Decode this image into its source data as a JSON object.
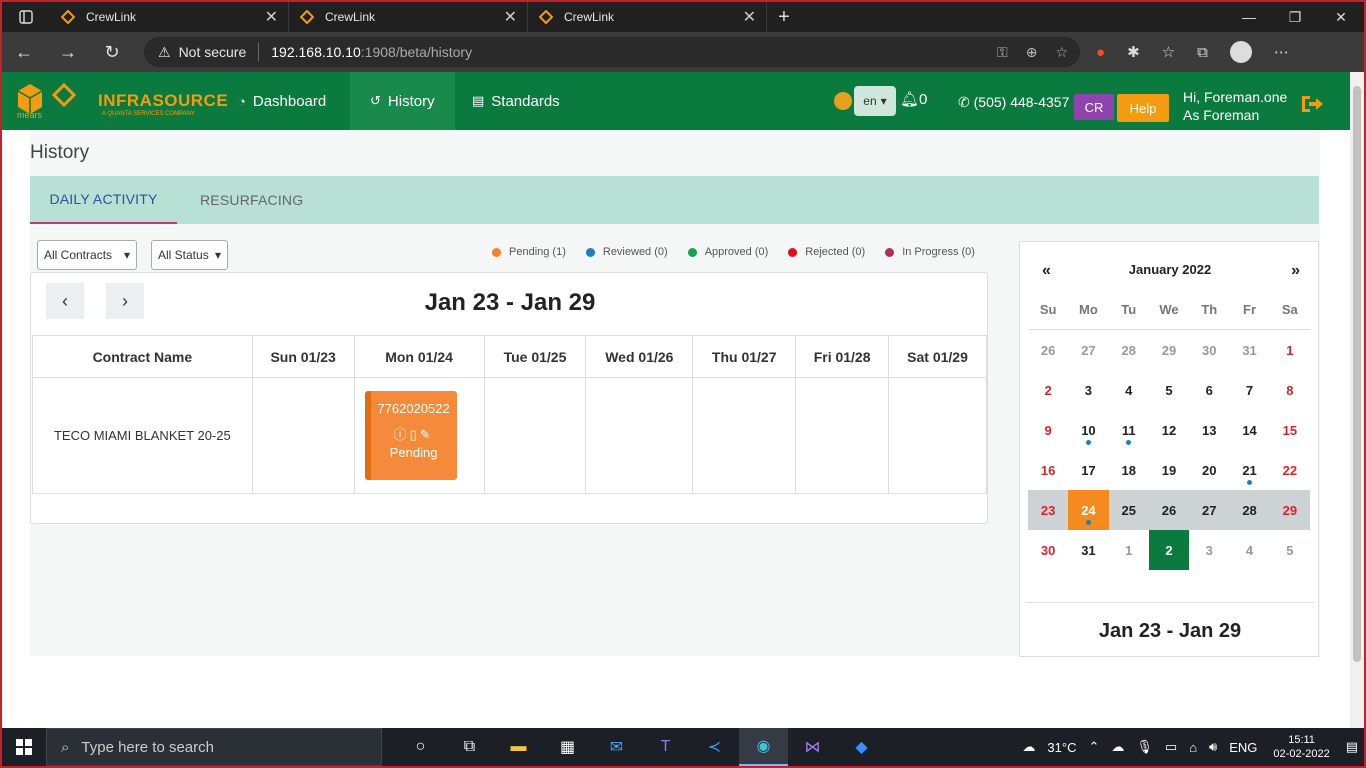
{
  "browser": {
    "tabs": [
      {
        "title": "CrewLink"
      },
      {
        "title": "CrewLink"
      },
      {
        "title": "CrewLink"
      }
    ],
    "security_label": "Not secure",
    "url_host": "192.168.10.10",
    "url_path": ":1908/beta/history"
  },
  "header": {
    "brand": "INFRASOURCE",
    "brand_sub": "A QUANTA SERVICES COMPANY",
    "mears": "mears",
    "nav": [
      {
        "label": "Dashboard",
        "icon": "dashboard-icon"
      },
      {
        "label": "History",
        "icon": "history-icon"
      },
      {
        "label": "Standards",
        "icon": "document-icon"
      }
    ],
    "language": "en",
    "notifications": "0",
    "phone": "(505) 448-4357",
    "cr_label": "CR",
    "help_label": "Help",
    "greeting": "Hi, Foreman.one",
    "role": "As Foreman"
  },
  "page": {
    "title": "History",
    "tabs": [
      "DAILY ACTIVITY",
      "RESURFACING"
    ],
    "filters": {
      "contracts": "All Contracts",
      "status": "All Status"
    },
    "legend": [
      {
        "label": "Pending (1)",
        "color": "#f5822a"
      },
      {
        "label": "Reviewed (0)",
        "color": "#1f7dc1"
      },
      {
        "label": "Approved (0)",
        "color": "#16a34a"
      },
      {
        "label": "Rejected (0)",
        "color": "#e0101a"
      },
      {
        "label": "In Progress (0)",
        "color": "#b0305a"
      }
    ]
  },
  "week": {
    "range": "Jan 23 - Jan 29",
    "columns": [
      "Contract Name",
      "Sun 01/23",
      "Mon 01/24",
      "Tue 01/25",
      "Wed 01/26",
      "Thu 01/27",
      "Fri 01/28",
      "Sat 01/29"
    ],
    "row": {
      "contract": "TECO MIAMI BLANKET 20-25",
      "entry": {
        "number": "7762020522",
        "status": "Pending"
      }
    }
  },
  "calendar": {
    "prev": "«",
    "next": "»",
    "month": "January 2022",
    "weekdays": [
      "Su",
      "Mo",
      "Tu",
      "We",
      "Th",
      "Fr",
      "Sa"
    ],
    "weeks": [
      [
        "26",
        "27",
        "28",
        "29",
        "30",
        "31",
        "1"
      ],
      [
        "2",
        "3",
        "4",
        "5",
        "6",
        "7",
        "8"
      ],
      [
        "9",
        "10",
        "11",
        "12",
        "13",
        "14",
        "15"
      ],
      [
        "16",
        "17",
        "18",
        "19",
        "20",
        "21",
        "22"
      ],
      [
        "23",
        "24",
        "25",
        "26",
        "27",
        "28",
        "29"
      ],
      [
        "30",
        "31",
        "1",
        "2",
        "3",
        "4",
        "5"
      ]
    ],
    "range": "Jan 23 - Jan 29"
  },
  "taskbar": {
    "search_placeholder": "Type here to search",
    "temperature": "31°C",
    "language": "ENG",
    "time": "15:11",
    "date": "02-02-2022"
  }
}
